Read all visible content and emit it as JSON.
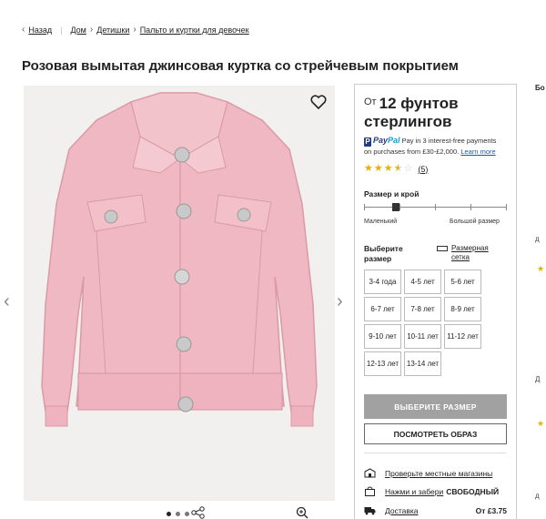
{
  "breadcrumb": {
    "back": "Назад",
    "items": [
      "Дом",
      "Детишки",
      "Пальто и куртки для девочек"
    ]
  },
  "product": {
    "title": "Розовая вымытая джинсовая куртка со стрейчевым покрытием"
  },
  "price": {
    "from": "От",
    "amount_line1": "12 фунтов",
    "amount_line2": "стерлингов"
  },
  "paypal": {
    "brand1": "Pay",
    "brand2": "Pal",
    "text1": "Pay in 3 interest-free payments",
    "text2": "on purchases from £30-£2,000.",
    "link": "Learn more"
  },
  "rating": {
    "stars": 3.5,
    "count": "(5)"
  },
  "fit": {
    "label": "Размер и крой",
    "small": "Маленький",
    "large": "Большой размер",
    "level": 0.2
  },
  "size": {
    "label": "Выберите размер",
    "guide": "Размерная сетка",
    "options": [
      "3-4 года",
      "4-5 лет",
      "5-6 лет",
      "6-7 лет",
      "7-8 лет",
      "8-9 лет",
      "9-10 лет",
      "10-11 лет",
      "11-12 лет",
      "12-13 лет",
      "13-14 лет"
    ]
  },
  "buttons": {
    "select_size": "ВЫБЕРИТЕ РАЗМЕР",
    "view_look": "ПОСМОТРЕТЬ ОБРАЗ"
  },
  "info": {
    "stores": "Проверьте местные магазины",
    "click_collect": "Нажми и забери",
    "click_collect_value": "СВОБОДНЫЙ",
    "delivery": "Доставка",
    "delivery_value": "От £3.75"
  },
  "side": {
    "letter": "Бо",
    "d1": "д",
    "d2": "Д",
    "d3": "д"
  },
  "colors": {
    "accent_gray": "#a1a1a1",
    "star": "#e8b200",
    "jacket_pink": "#f1bcc6"
  }
}
